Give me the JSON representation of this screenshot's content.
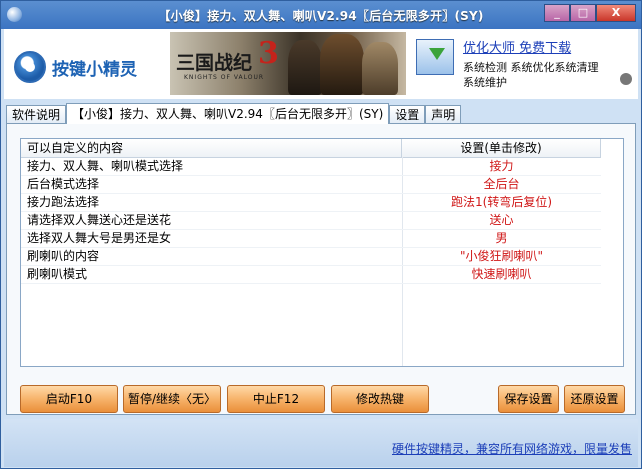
{
  "window": {
    "title": "【小俊】接力、双人舞、喇叭V2.94〖后台无限多开〗(SY)",
    "buttons": [
      "_",
      "□",
      "X"
    ]
  },
  "header": {
    "logo_text": "按键小精灵",
    "banner_title": "三国战纪",
    "banner_number": "3",
    "banner_subtitle": "KNIGHTS OF VALOUR",
    "ad": {
      "title": "优化大师 免费下载",
      "line1": "系统检测 系统优化系统清理",
      "line2": "系统维护"
    }
  },
  "tabs": [
    {
      "label": "软件说明",
      "active": false
    },
    {
      "label": "【小俊】接力、双人舞、喇叭V2.94〖后台无限多开〗(SY)",
      "active": true
    },
    {
      "label": "设置",
      "active": false
    },
    {
      "label": "声明",
      "active": false
    }
  ],
  "list": {
    "headers": [
      "可以自定义的内容",
      "设置(单击修改)"
    ],
    "rows": [
      {
        "item": "接力、双人舞、喇叭模式选择",
        "value": "接力"
      },
      {
        "item": "后台模式选择",
        "value": "全后台"
      },
      {
        "item": "接力跑法选择",
        "value": "跑法1(转弯后复位)"
      },
      {
        "item": "请选择双人舞送心还是送花",
        "value": "送心"
      },
      {
        "item": "选择双人舞大号是男还是女",
        "value": "男"
      },
      {
        "item": "刷喇叭的内容",
        "value": "\"小俊狂刷喇叭\""
      },
      {
        "item": "刷喇叭模式",
        "value": "快速刷喇叭"
      }
    ]
  },
  "buttons": {
    "start": "启动F10",
    "pause": "暂停/继续〈无〉",
    "stop": "中止F12",
    "hotkey": "修改热键",
    "save": "保存设置",
    "restore": "还原设置"
  },
  "footer": {
    "link": "硬件按键精灵，兼容所有网络游戏，限量发售"
  },
  "colors": {
    "value_text": "#d01818",
    "button_orange": "#f7b36b",
    "link_blue": "#1c3fb8"
  }
}
